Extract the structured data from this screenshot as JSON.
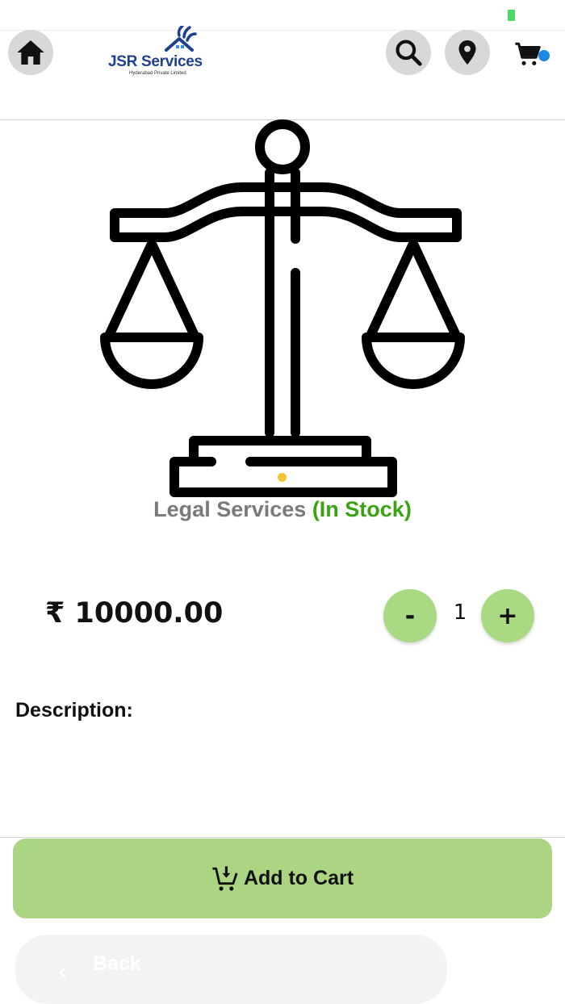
{
  "header": {
    "logo_text": "JSR Services",
    "logo_sub": "Hyderabad Private Limited",
    "icons": {
      "home": "home-icon",
      "search": "search-icon",
      "location": "location-pin-icon",
      "cart": "cart-icon"
    }
  },
  "product": {
    "image": "scales-of-justice-icon",
    "name": "Legal Services",
    "stock": "(In Stock)",
    "price": "₹ 10000.00",
    "description_label": "Description:"
  },
  "quantity": {
    "minus_label": "-",
    "value": "1",
    "plus_label": "+"
  },
  "actions": {
    "add_to_cart_label": "Add to Cart",
    "back_label": "Back"
  },
  "colors": {
    "accent_green": "#abd582",
    "stock_green": "#3aa312",
    "badge_blue": "#1e88e5",
    "carousel_dot": "#f4c430",
    "logo_blue": "#1f3f8f"
  }
}
